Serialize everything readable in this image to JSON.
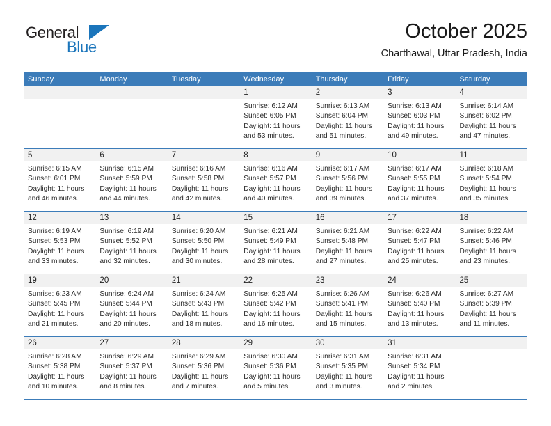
{
  "brand": {
    "name_top": "General",
    "name_bottom": "Blue",
    "accent_color": "#1b75bb",
    "triangle_icon": "triangle-icon"
  },
  "header": {
    "title": "October 2025",
    "subtitle": "Charthawal, Uttar Pradesh, India"
  },
  "calendar": {
    "header_bg": "#3c7cb9",
    "daynum_bg": "#f1f1f1",
    "weekdays": [
      "Sunday",
      "Monday",
      "Tuesday",
      "Wednesday",
      "Thursday",
      "Friday",
      "Saturday"
    ],
    "weeks": [
      [
        {
          "day": "",
          "lines": []
        },
        {
          "day": "",
          "lines": []
        },
        {
          "day": "",
          "lines": []
        },
        {
          "day": "1",
          "lines": [
            "Sunrise: 6:12 AM",
            "Sunset: 6:05 PM",
            "Daylight: 11 hours",
            "and 53 minutes."
          ]
        },
        {
          "day": "2",
          "lines": [
            "Sunrise: 6:13 AM",
            "Sunset: 6:04 PM",
            "Daylight: 11 hours",
            "and 51 minutes."
          ]
        },
        {
          "day": "3",
          "lines": [
            "Sunrise: 6:13 AM",
            "Sunset: 6:03 PM",
            "Daylight: 11 hours",
            "and 49 minutes."
          ]
        },
        {
          "day": "4",
          "lines": [
            "Sunrise: 6:14 AM",
            "Sunset: 6:02 PM",
            "Daylight: 11 hours",
            "and 47 minutes."
          ]
        }
      ],
      [
        {
          "day": "5",
          "lines": [
            "Sunrise: 6:15 AM",
            "Sunset: 6:01 PM",
            "Daylight: 11 hours",
            "and 46 minutes."
          ]
        },
        {
          "day": "6",
          "lines": [
            "Sunrise: 6:15 AM",
            "Sunset: 5:59 PM",
            "Daylight: 11 hours",
            "and 44 minutes."
          ]
        },
        {
          "day": "7",
          "lines": [
            "Sunrise: 6:16 AM",
            "Sunset: 5:58 PM",
            "Daylight: 11 hours",
            "and 42 minutes."
          ]
        },
        {
          "day": "8",
          "lines": [
            "Sunrise: 6:16 AM",
            "Sunset: 5:57 PM",
            "Daylight: 11 hours",
            "and 40 minutes."
          ]
        },
        {
          "day": "9",
          "lines": [
            "Sunrise: 6:17 AM",
            "Sunset: 5:56 PM",
            "Daylight: 11 hours",
            "and 39 minutes."
          ]
        },
        {
          "day": "10",
          "lines": [
            "Sunrise: 6:17 AM",
            "Sunset: 5:55 PM",
            "Daylight: 11 hours",
            "and 37 minutes."
          ]
        },
        {
          "day": "11",
          "lines": [
            "Sunrise: 6:18 AM",
            "Sunset: 5:54 PM",
            "Daylight: 11 hours",
            "and 35 minutes."
          ]
        }
      ],
      [
        {
          "day": "12",
          "lines": [
            "Sunrise: 6:19 AM",
            "Sunset: 5:53 PM",
            "Daylight: 11 hours",
            "and 33 minutes."
          ]
        },
        {
          "day": "13",
          "lines": [
            "Sunrise: 6:19 AM",
            "Sunset: 5:52 PM",
            "Daylight: 11 hours",
            "and 32 minutes."
          ]
        },
        {
          "day": "14",
          "lines": [
            "Sunrise: 6:20 AM",
            "Sunset: 5:50 PM",
            "Daylight: 11 hours",
            "and 30 minutes."
          ]
        },
        {
          "day": "15",
          "lines": [
            "Sunrise: 6:21 AM",
            "Sunset: 5:49 PM",
            "Daylight: 11 hours",
            "and 28 minutes."
          ]
        },
        {
          "day": "16",
          "lines": [
            "Sunrise: 6:21 AM",
            "Sunset: 5:48 PM",
            "Daylight: 11 hours",
            "and 27 minutes."
          ]
        },
        {
          "day": "17",
          "lines": [
            "Sunrise: 6:22 AM",
            "Sunset: 5:47 PM",
            "Daylight: 11 hours",
            "and 25 minutes."
          ]
        },
        {
          "day": "18",
          "lines": [
            "Sunrise: 6:22 AM",
            "Sunset: 5:46 PM",
            "Daylight: 11 hours",
            "and 23 minutes."
          ]
        }
      ],
      [
        {
          "day": "19",
          "lines": [
            "Sunrise: 6:23 AM",
            "Sunset: 5:45 PM",
            "Daylight: 11 hours",
            "and 21 minutes."
          ]
        },
        {
          "day": "20",
          "lines": [
            "Sunrise: 6:24 AM",
            "Sunset: 5:44 PM",
            "Daylight: 11 hours",
            "and 20 minutes."
          ]
        },
        {
          "day": "21",
          "lines": [
            "Sunrise: 6:24 AM",
            "Sunset: 5:43 PM",
            "Daylight: 11 hours",
            "and 18 minutes."
          ]
        },
        {
          "day": "22",
          "lines": [
            "Sunrise: 6:25 AM",
            "Sunset: 5:42 PM",
            "Daylight: 11 hours",
            "and 16 minutes."
          ]
        },
        {
          "day": "23",
          "lines": [
            "Sunrise: 6:26 AM",
            "Sunset: 5:41 PM",
            "Daylight: 11 hours",
            "and 15 minutes."
          ]
        },
        {
          "day": "24",
          "lines": [
            "Sunrise: 6:26 AM",
            "Sunset: 5:40 PM",
            "Daylight: 11 hours",
            "and 13 minutes."
          ]
        },
        {
          "day": "25",
          "lines": [
            "Sunrise: 6:27 AM",
            "Sunset: 5:39 PM",
            "Daylight: 11 hours",
            "and 11 minutes."
          ]
        }
      ],
      [
        {
          "day": "26",
          "lines": [
            "Sunrise: 6:28 AM",
            "Sunset: 5:38 PM",
            "Daylight: 11 hours",
            "and 10 minutes."
          ]
        },
        {
          "day": "27",
          "lines": [
            "Sunrise: 6:29 AM",
            "Sunset: 5:37 PM",
            "Daylight: 11 hours",
            "and 8 minutes."
          ]
        },
        {
          "day": "28",
          "lines": [
            "Sunrise: 6:29 AM",
            "Sunset: 5:36 PM",
            "Daylight: 11 hours",
            "and 7 minutes."
          ]
        },
        {
          "day": "29",
          "lines": [
            "Sunrise: 6:30 AM",
            "Sunset: 5:36 PM",
            "Daylight: 11 hours",
            "and 5 minutes."
          ]
        },
        {
          "day": "30",
          "lines": [
            "Sunrise: 6:31 AM",
            "Sunset: 5:35 PM",
            "Daylight: 11 hours",
            "and 3 minutes."
          ]
        },
        {
          "day": "31",
          "lines": [
            "Sunrise: 6:31 AM",
            "Sunset: 5:34 PM",
            "Daylight: 11 hours",
            "and 2 minutes."
          ]
        },
        {
          "day": "",
          "lines": []
        }
      ]
    ]
  }
}
